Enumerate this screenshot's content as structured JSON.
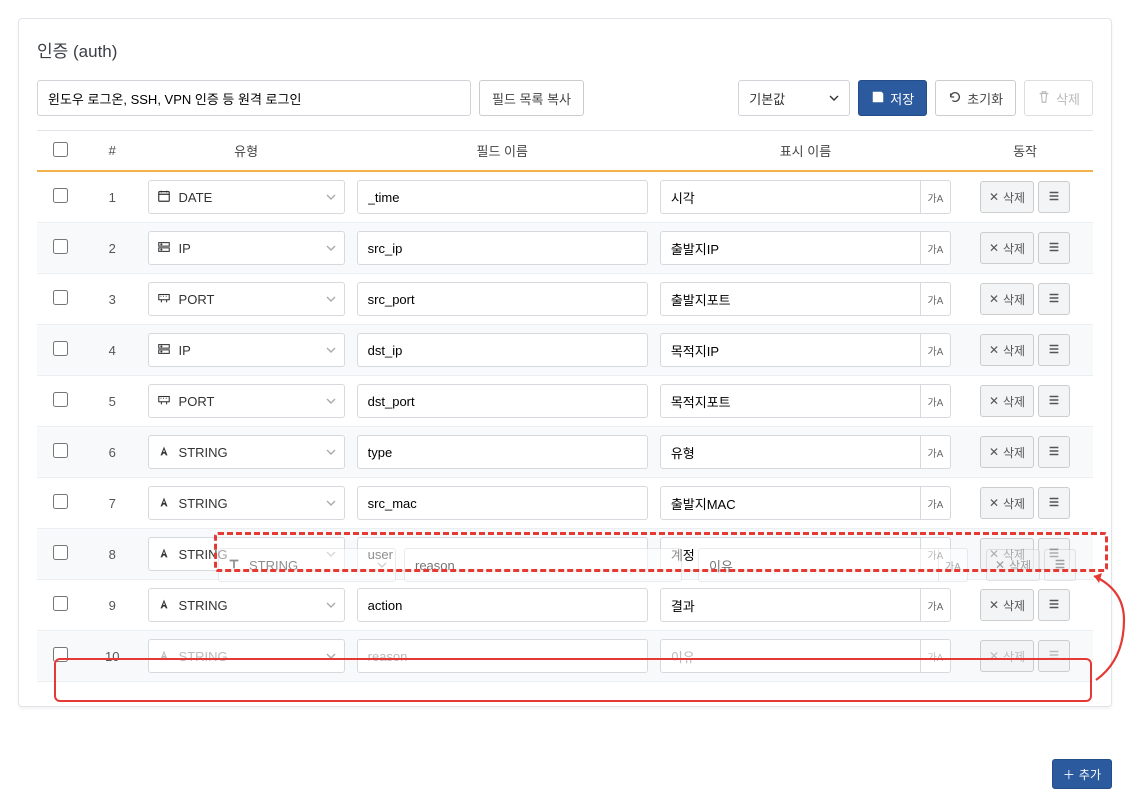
{
  "title": "인증 (auth)",
  "description": "윈도우 로그온, SSH, VPN 인증 등 원격 로그인",
  "buttons": {
    "copy_fields": "필드 목록 복사",
    "default": "기본값",
    "save": "저장",
    "reset": "초기화",
    "delete_top": "삭제",
    "add": "추가"
  },
  "columns": {
    "cb": "",
    "idx": "#",
    "type": "유형",
    "field": "필드 이름",
    "display": "표시 이름",
    "action": "동작"
  },
  "row_action_delete": "삭제",
  "type_options": {
    "DATE": "DATE",
    "IP": "IP",
    "PORT": "PORT",
    "STRING": "STRING"
  },
  "lang_label": "가A",
  "rows": [
    {
      "idx": "1",
      "type": "DATE",
      "field": "_time",
      "display": "시각"
    },
    {
      "idx": "2",
      "type": "IP",
      "field": "src_ip",
      "display": "출발지IP"
    },
    {
      "idx": "3",
      "type": "PORT",
      "field": "src_port",
      "display": "출발지포트"
    },
    {
      "idx": "4",
      "type": "IP",
      "field": "dst_ip",
      "display": "목적지IP"
    },
    {
      "idx": "5",
      "type": "PORT",
      "field": "dst_port",
      "display": "목적지포트"
    },
    {
      "idx": "6",
      "type": "STRING",
      "field": "type",
      "display": "유형"
    },
    {
      "idx": "7",
      "type": "STRING",
      "field": "src_mac",
      "display": "출발지MAC"
    },
    {
      "idx": "8",
      "type": "STRING",
      "field": "user",
      "display": "계정"
    },
    {
      "idx": "9",
      "type": "STRING",
      "field": "action",
      "display": "결과"
    },
    {
      "idx": "10",
      "type": "STRING",
      "field": "reason",
      "display": "이유",
      "faded": true
    }
  ],
  "ghost": {
    "idx": "10",
    "type": "STRING",
    "field": "reason",
    "display": "이유"
  }
}
